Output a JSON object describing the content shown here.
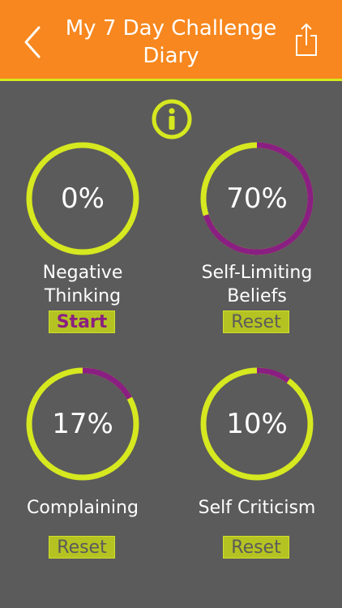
{
  "header": {
    "title_line1": "My 7 Day Challenge",
    "title_line2": "Diary",
    "back_icon": "chevron-left-icon",
    "share_icon": "share-icon"
  },
  "info_icon": "info-icon",
  "colors": {
    "header_bg": "#f7871e",
    "accent_green": "#d6e81f",
    "progress_purple": "#8a1f82",
    "background": "#5b5b5b"
  },
  "challenges": [
    {
      "percent_text": "0%",
      "percent": 0,
      "label_line1": "Negative",
      "label_line2": "Thinking",
      "button": "Start"
    },
    {
      "percent_text": "70%",
      "percent": 70,
      "label_line1": "Self-Limiting",
      "label_line2": "Beliefs",
      "button": "Reset"
    },
    {
      "percent_text": "17%",
      "percent": 17,
      "label_line1": "Complaining",
      "label_line2": "",
      "button": "Reset"
    },
    {
      "percent_text": "10%",
      "percent": 10,
      "label_line1": "Self Criticism",
      "label_line2": "",
      "button": "Reset"
    }
  ]
}
